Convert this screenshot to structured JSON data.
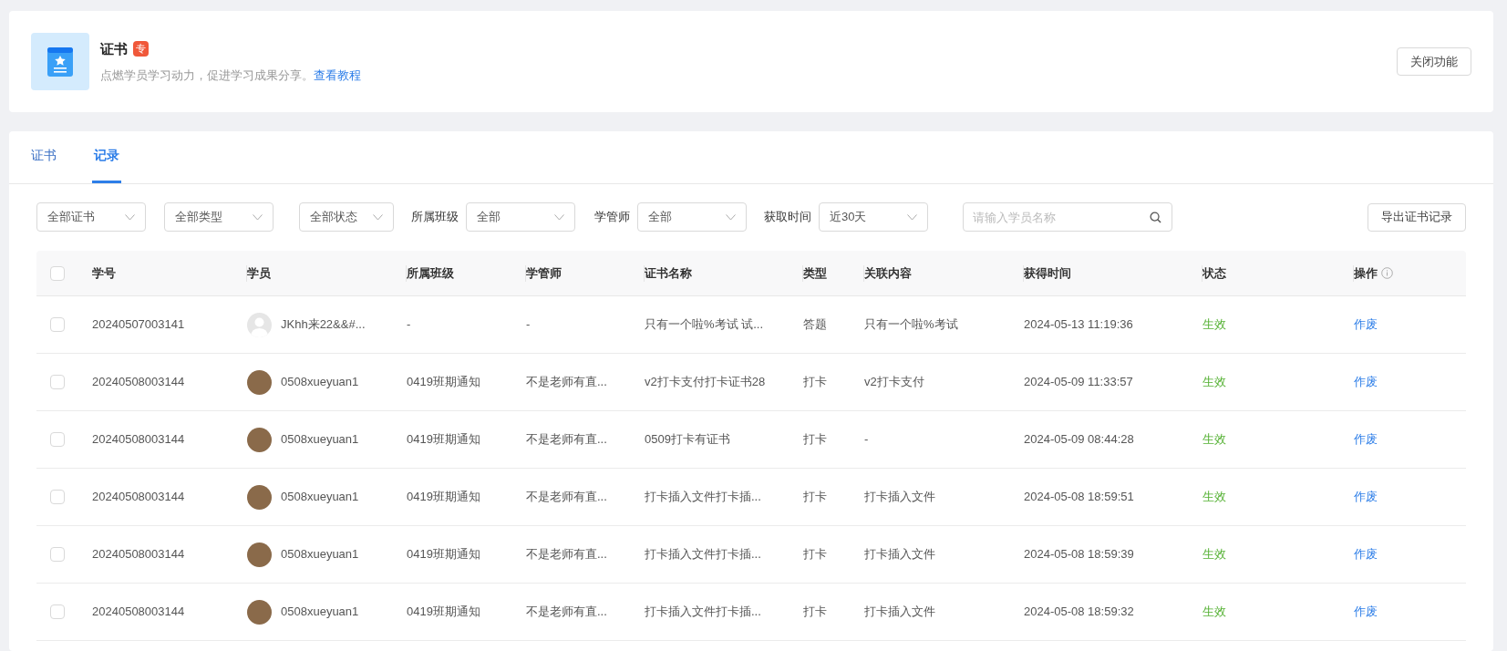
{
  "feature": {
    "title": "证书",
    "badge": "专",
    "description": "点燃学员学习动力，促进学习成果分享。",
    "tutorial_link": "查看教程",
    "close_button": "关闭功能"
  },
  "tabs": [
    {
      "label": "证书",
      "selected": false
    },
    {
      "label": "记录",
      "selected": true
    }
  ],
  "filters": [
    {
      "value": "全部证书"
    },
    {
      "value": "全部类型"
    },
    {
      "value": "全部状态"
    },
    {
      "label": "所属班级",
      "value": "全部"
    },
    {
      "label": "学管师",
      "value": "全部"
    },
    {
      "label": "获取时间",
      "value": "近30天"
    }
  ],
  "search": {
    "placeholder": "请输入学员名称"
  },
  "export_button": "导出证书记录",
  "table": {
    "select_all_checked": false,
    "columns": [
      "学号",
      "学员",
      "所属班级",
      "学管师",
      "证书名称",
      "类型",
      "关联内容",
      "获得时间",
      "状态",
      "操作"
    ],
    "rows": [
      {
        "checked": false,
        "student_id": "20240507003141",
        "avatar_photo": false,
        "student": "JKhh来22&&#...",
        "class": "-",
        "manager": "-",
        "certificate": "只有一个啦%考试 试...",
        "type": "答题",
        "related": "只有一个啦%考试",
        "time": "2024-05-13 11:19:36",
        "status": "生效",
        "action": "作废"
      },
      {
        "checked": false,
        "student_id": "20240508003144",
        "avatar_photo": true,
        "student": "0508xueyuan1",
        "class": "0419班期通知",
        "manager": "不是老师有直...",
        "certificate": "v2打卡支付打卡证书28",
        "type": "打卡",
        "related": "v2打卡支付",
        "time": "2024-05-09 11:33:57",
        "status": "生效",
        "action": "作废"
      },
      {
        "checked": false,
        "student_id": "20240508003144",
        "avatar_photo": true,
        "student": "0508xueyuan1",
        "class": "0419班期通知",
        "manager": "不是老师有直...",
        "certificate": "0509打卡有证书",
        "type": "打卡",
        "related": "-",
        "time": "2024-05-09 08:44:28",
        "status": "生效",
        "action": "作废"
      },
      {
        "checked": false,
        "student_id": "20240508003144",
        "avatar_photo": true,
        "student": "0508xueyuan1",
        "class": "0419班期通知",
        "manager": "不是老师有直...",
        "certificate": "打卡插入文件打卡插...",
        "type": "打卡",
        "related": "打卡插入文件",
        "time": "2024-05-08 18:59:51",
        "status": "生效",
        "action": "作废"
      },
      {
        "checked": false,
        "student_id": "20240508003144",
        "avatar_photo": true,
        "student": "0508xueyuan1",
        "class": "0419班期通知",
        "manager": "不是老师有直...",
        "certificate": "打卡插入文件打卡插...",
        "type": "打卡",
        "related": "打卡插入文件",
        "time": "2024-05-08 18:59:39",
        "status": "生效",
        "action": "作废"
      },
      {
        "checked": false,
        "student_id": "20240508003144",
        "avatar_photo": true,
        "student": "0508xueyuan1",
        "class": "0419班期通知",
        "manager": "不是老师有直...",
        "certificate": "打卡插入文件打卡插...",
        "type": "打卡",
        "related": "打卡插入文件",
        "time": "2024-05-08 18:59:32",
        "status": "生效",
        "action": "作废"
      }
    ]
  }
}
